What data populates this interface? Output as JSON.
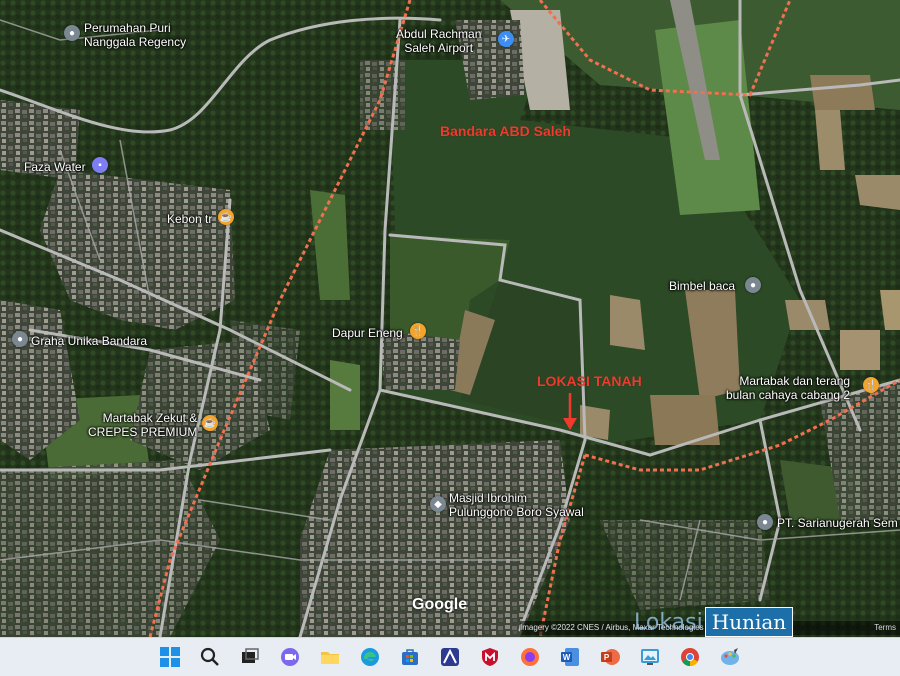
{
  "map": {
    "places": [
      {
        "id": "puri",
        "label": "Perumahan Puri\nNanggala Regency",
        "icon": "map-pin-icon",
        "color": "gray"
      },
      {
        "id": "airport",
        "label": "Abdul Rachman\nSaleh Airport",
        "icon": "airport-icon",
        "color": "blue"
      },
      {
        "id": "faza",
        "label": "Faza Water",
        "icon": "shop-bag-icon",
        "color": "violet"
      },
      {
        "id": "kebon",
        "label": "Kebon tr",
        "icon": "cafe-cup-icon",
        "color": "orange"
      },
      {
        "id": "graha",
        "label": "Graha Unika Bandara",
        "icon": "map-pin-icon",
        "color": "gray"
      },
      {
        "id": "dapur",
        "label": "Dapur Eneng",
        "icon": "restaurant-icon",
        "color": "orange"
      },
      {
        "id": "bimbel",
        "label": "Bimbel baca",
        "icon": "map-pin-icon",
        "color": "gray"
      },
      {
        "id": "martabak_terang",
        "label": "Martabak dan terang\nbulan cahaya cabang 2",
        "icon": "restaurant-icon",
        "color": "orange"
      },
      {
        "id": "martabak_zekut",
        "label": "Martabak Zekut &\nCREPES PREMIUM",
        "icon": "cafe-cup-icon",
        "color": "orange"
      },
      {
        "id": "masjid",
        "label": "Masjid Ibrohim\nPulunggono Boro Syawal",
        "icon": "mosque-icon",
        "color": "gray"
      },
      {
        "id": "pt",
        "label": "PT. Sarianugerah Sem",
        "icon": "map-pin-icon",
        "color": "gray"
      }
    ],
    "annotations": {
      "bandara": "Bandara ABD Saleh",
      "lokasi": "LOKASI TANAH"
    },
    "google_logo": "Google",
    "attribution": "Imagery ©2022 CNES / Airbus, Maxar Technologies",
    "terms": "Terms",
    "watermark": {
      "left": "Lokasi",
      "right": "Hunian"
    }
  },
  "taskbar": {
    "apps": [
      "windows-start-icon",
      "search-icon",
      "task-view-icon",
      "chat-icon",
      "file-explorer-icon",
      "edge-icon",
      "store-icon",
      "affinity-icon",
      "mcafee-icon",
      "firefox-icon",
      "word-icon",
      "powerpoint-icon",
      "photos-icon",
      "chrome-icon",
      "paint-icon"
    ]
  },
  "colors": {
    "annotation": "#f03a2e",
    "boundary": "#f07050",
    "road": "#b9b9b9",
    "taskbar": "#e8edf3"
  }
}
